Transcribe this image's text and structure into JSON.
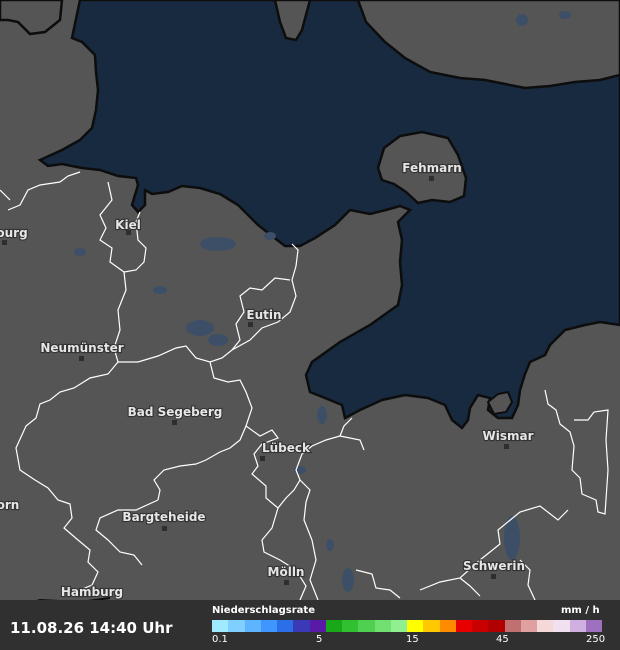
{
  "map": {
    "cities": [
      "Fehmarn",
      "Kiel",
      "Eutin",
      "Neumünster",
      "Bad Segeberg",
      "Lübeck",
      "Wismar",
      "Bargteheide",
      "Mölln",
      "Schwerin",
      "Hamburg",
      "ourg",
      "orn"
    ]
  },
  "footer": {
    "timestamp": "11.08.26 14:40 Uhr",
    "legend_title": "Niederschlagsrate",
    "legend_unit": "mm / h",
    "ticks": [
      "0.1",
      "5",
      "15",
      "45",
      "250"
    ],
    "colors": [
      "#a0eaff",
      "#80d0ff",
      "#5fb4ff",
      "#3f96ff",
      "#2b6fe8",
      "#3a3ab8",
      "#5a1aa8",
      "#18a818",
      "#30c030",
      "#50d050",
      "#70e070",
      "#90f090",
      "#ffff00",
      "#ffc800",
      "#ff8c00",
      "#e80000",
      "#c80000",
      "#b00000",
      "#c07070",
      "#e0a0a0",
      "#f5d8d8",
      "#f0e0f0",
      "#d0b0e0",
      "#a070c0"
    ]
  },
  "colors": {
    "sea": "#172a40",
    "land": "#555555",
    "coast": "#0d0d0d",
    "border": "#ffffff",
    "bar": "#303030"
  }
}
